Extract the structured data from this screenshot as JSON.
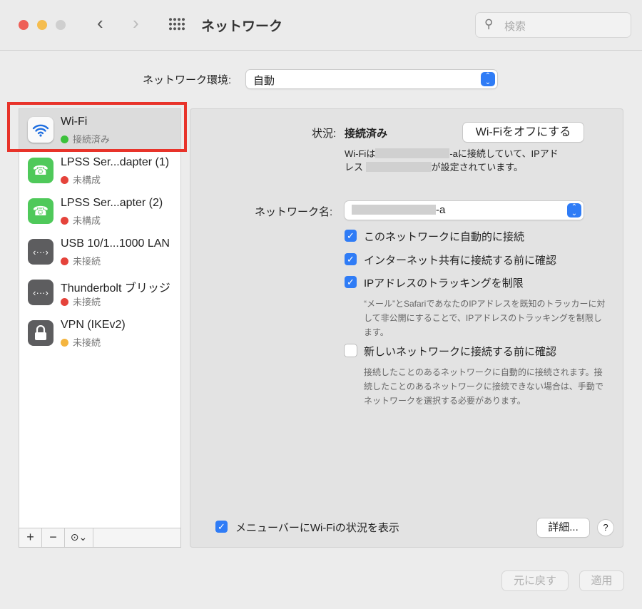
{
  "window": {
    "title": "ネットワーク",
    "search_placeholder": "検索"
  },
  "location": {
    "label": "ネットワーク環境:",
    "value": "自動"
  },
  "services": [
    {
      "name": "Wi-Fi",
      "status": "接続済み",
      "status_color": "#3cc13b",
      "icon": "wifi-icon"
    },
    {
      "name": "LPSS Ser...dapter (1)",
      "status": "未構成",
      "status_color": "#e5433b",
      "icon": "phone-icon"
    },
    {
      "name": "LPSS Ser...apter (2)",
      "status": "未構成",
      "status_color": "#e5433b",
      "icon": "phone-icon"
    },
    {
      "name": "USB 10/1...1000 LAN",
      "status": "未接続",
      "status_color": "#e5433b",
      "icon": "ethernet-icon"
    },
    {
      "name": "Thunderbolt ブリッジ",
      "status": "未接続",
      "status_color": "#e5433b",
      "icon": "ethernet-icon"
    },
    {
      "name": "VPN (IKEv2)",
      "status": "未接続",
      "status_color": "#f4b53f",
      "icon": "lock-icon"
    }
  ],
  "toolbar": {
    "add": "+",
    "remove": "−",
    "more": "⊙⌄"
  },
  "detail": {
    "status_label": "状況:",
    "status_value": "接続済み",
    "wifi_off_button": "Wi-Fiをオフにする",
    "status_desc_1a": "Wi-Fiは",
    "status_desc_1b": "-aに接続していて、IPアド",
    "status_desc_2a": "レス",
    "status_desc_2b": "が設定されています。",
    "network_label": "ネットワーク名:",
    "network_value_suffix": "-a",
    "options": [
      {
        "label": "このネットワークに自動的に接続",
        "checked": true
      },
      {
        "label": "インターネット共有に接続する前に確認",
        "checked": true
      },
      {
        "label": "IPアドレスのトラッキングを制限",
        "checked": true
      },
      {
        "label": "新しいネットワークに接続する前に確認",
        "checked": false
      }
    ],
    "note_tracking": "“メール”とSafariであなたのIPアドレスを既知のトラッカーに対して非公開にすることで、IPアドレスのトラッキングを制限します。",
    "note_new": "接続したことのあるネットワークに自動的に接続されます。接続したことのあるネットワークに接続できない場合は、手動でネットワークを選択する必要があります。",
    "menubar_label": "メニューバーにWi-Fiの状況を表示",
    "advanced_button": "詳細...",
    "help_button": "?"
  },
  "footer": {
    "revert": "元に戻す",
    "apply": "適用"
  }
}
